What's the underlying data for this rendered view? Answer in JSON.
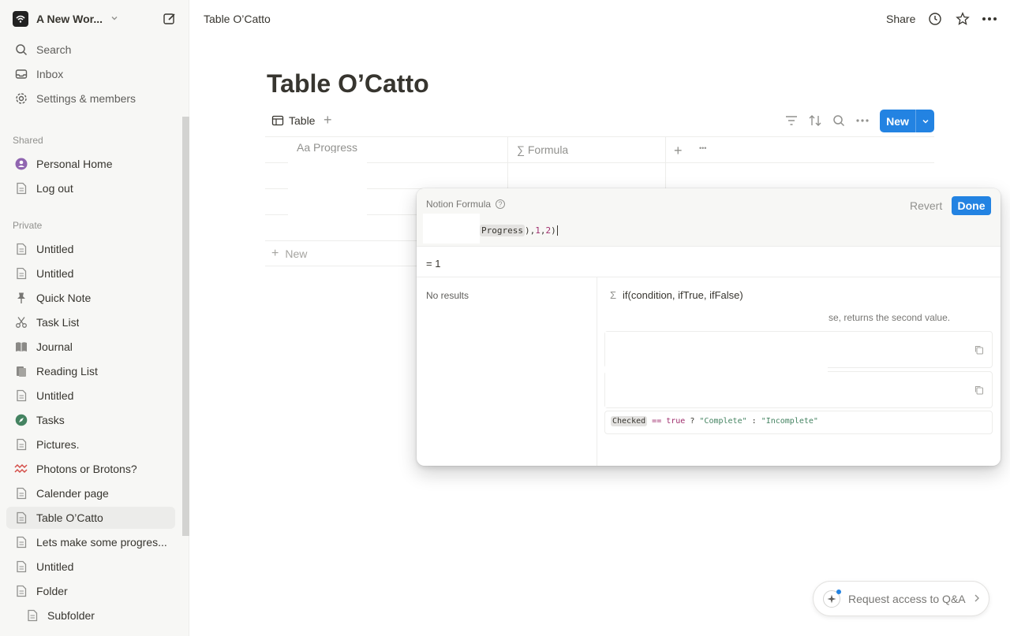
{
  "workspace": {
    "name": "A New Wor..."
  },
  "sidebar": {
    "top_items": [
      {
        "label": "Search",
        "icon": "search-icon"
      },
      {
        "label": "Inbox",
        "icon": "inbox-icon"
      },
      {
        "label": "Settings & members",
        "icon": "gear-icon"
      }
    ],
    "shared_heading": "Shared",
    "shared_items": [
      {
        "label": "Personal Home",
        "icon": "avatar-icon"
      },
      {
        "label": "Log out",
        "icon": "page-icon"
      }
    ],
    "private_heading": "Private",
    "private_items": [
      {
        "label": "Untitled",
        "icon": "page-icon"
      },
      {
        "label": "Untitled",
        "icon": "page-icon"
      },
      {
        "label": "Quick Note",
        "icon": "pin-icon"
      },
      {
        "label": "Task List",
        "icon": "scissors-icon"
      },
      {
        "label": "Journal",
        "icon": "book-icon"
      },
      {
        "label": "Reading List",
        "icon": "books-icon"
      },
      {
        "label": "Untitled",
        "icon": "page-icon"
      },
      {
        "label": "Tasks",
        "icon": "compass-icon"
      },
      {
        "label": "Pictures.",
        "icon": "page-icon"
      },
      {
        "label": "Photons or Brotons?",
        "icon": "wave-icon"
      },
      {
        "label": "Calender page",
        "icon": "page-icon"
      },
      {
        "label": "Table O’Catto",
        "icon": "page-icon",
        "active": true
      },
      {
        "label": "Lets make some progres...",
        "icon": "page-icon"
      },
      {
        "label": "Untitled",
        "icon": "page-icon"
      },
      {
        "label": "Folder",
        "icon": "page-icon"
      },
      {
        "label": "Subfolder",
        "icon": "page-icon"
      }
    ]
  },
  "topbar": {
    "breadcrumb": "Table O’Catto",
    "share_label": "Share"
  },
  "page": {
    "title": "Table O’Catto",
    "view_tab": "Table",
    "new_button": "New",
    "columns": [
      {
        "label": "Aa Progress"
      },
      {
        "label": "∑ Formula"
      }
    ],
    "add_column": "+",
    "more": "•••",
    "new_row_label": "New"
  },
  "formula_popup": {
    "label": "Notion Formula",
    "revert_label": "Revert",
    "done_label": "Done",
    "code": {
      "token": "Progress",
      "rest_a": "), ",
      "num1": "1",
      "sep": ", ",
      "num2": "2",
      "close": ")"
    },
    "result": "= 1",
    "no_results": "No results",
    "function_signature": "if(condition, ifTrue, ifFalse)",
    "function_desc": "se, returns the second value.",
    "example": {
      "token": "Checked",
      "op": " == ",
      "kw": "true",
      "q": " ? ",
      "s1": "\"Complete\"",
      "colon": " : ",
      "s2": "\"Incomplete\""
    }
  },
  "qa_button": {
    "label": "Request access to Q&A"
  }
}
